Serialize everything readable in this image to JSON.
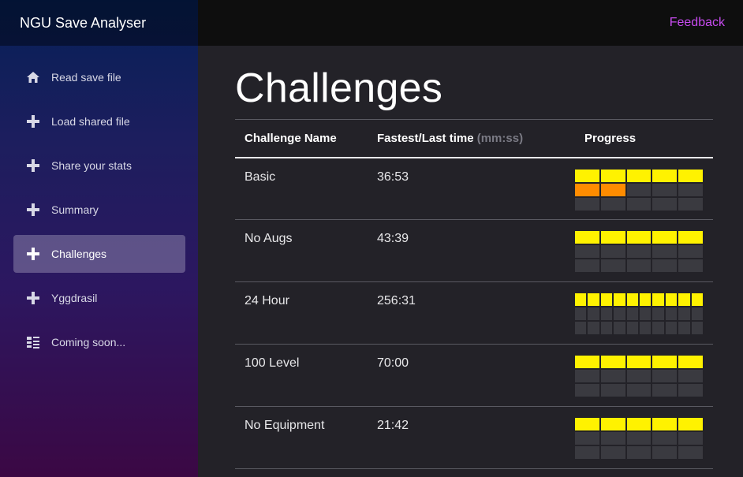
{
  "app": {
    "title": "NGU Save Analyser"
  },
  "topbar": {
    "feedback_label": "Feedback"
  },
  "sidebar": {
    "items": [
      {
        "label": "Read save file",
        "icon": "home-icon",
        "active": false
      },
      {
        "label": "Load shared file",
        "icon": "plus-icon",
        "active": false
      },
      {
        "label": "Share your stats",
        "icon": "plus-icon",
        "active": false
      },
      {
        "label": "Summary",
        "icon": "plus-icon",
        "active": false
      },
      {
        "label": "Challenges",
        "icon": "plus-icon",
        "active": true
      },
      {
        "label": "Yggdrasil",
        "icon": "plus-icon",
        "active": false
      },
      {
        "label": "Coming soon...",
        "icon": "list-grid-icon",
        "active": false
      }
    ]
  },
  "page": {
    "title": "Challenges"
  },
  "table": {
    "headers": {
      "name": "Challenge Name",
      "time": "Fastest/Last time",
      "time_unit": "(mm:ss)",
      "progress": "Progress"
    },
    "rows": [
      {
        "name": "Basic",
        "time": "36:53",
        "cols": 5,
        "progress": [
          [
            1,
            1,
            1,
            1,
            1
          ],
          [
            2,
            2,
            0,
            0,
            0
          ],
          [
            0,
            0,
            0,
            0,
            0
          ]
        ]
      },
      {
        "name": "No Augs",
        "time": "43:39",
        "cols": 5,
        "progress": [
          [
            1,
            1,
            1,
            1,
            1
          ],
          [
            0,
            0,
            0,
            0,
            0
          ],
          [
            0,
            0,
            0,
            0,
            0
          ]
        ]
      },
      {
        "name": "24 Hour",
        "time": "256:31",
        "cols": 10,
        "progress": [
          [
            1,
            1,
            1,
            1,
            1,
            1,
            1,
            1,
            1,
            1
          ],
          [
            0,
            0,
            0,
            0,
            0,
            0,
            0,
            0,
            0,
            0
          ],
          [
            0,
            0,
            0,
            0,
            0,
            0,
            0,
            0,
            0,
            0
          ]
        ]
      },
      {
        "name": "100 Level",
        "time": "70:00",
        "cols": 5,
        "progress": [
          [
            1,
            1,
            1,
            1,
            1
          ],
          [
            0,
            0,
            0,
            0,
            0
          ],
          [
            0,
            0,
            0,
            0,
            0
          ]
        ]
      },
      {
        "name": "No Equipment",
        "time": "21:42",
        "cols": 5,
        "progress": [
          [
            1,
            1,
            1,
            1,
            1
          ],
          [
            0,
            0,
            0,
            0,
            0
          ],
          [
            0,
            0,
            0,
            0,
            0
          ]
        ]
      }
    ]
  },
  "colors": {
    "accent_link": "#c84bf0",
    "progress_done": "#fff200",
    "progress_partial": "#ff8c00",
    "progress_empty": "#3a3a40",
    "active_nav": "rgba(255,255,255,0.25)"
  }
}
